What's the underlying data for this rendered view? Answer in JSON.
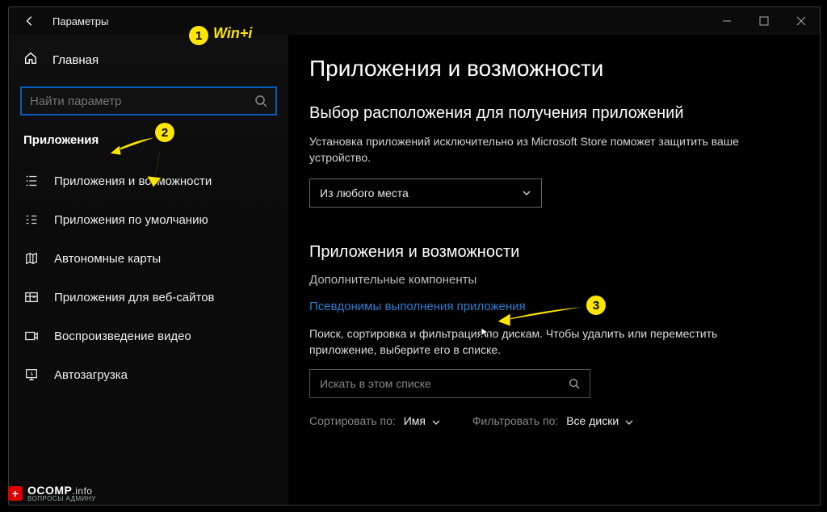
{
  "window_title": "Параметры",
  "annotations": {
    "hint1": "Win+i",
    "badge1": "1",
    "badge2": "2",
    "badge3": "3"
  },
  "sidebar": {
    "home_label": "Главная",
    "search_placeholder": "Найти параметр",
    "section_label": "Приложения",
    "items": [
      {
        "label": "Приложения и возможности"
      },
      {
        "label": "Приложения по умолчанию"
      },
      {
        "label": "Автономные карты"
      },
      {
        "label": "Приложения для веб-сайтов"
      },
      {
        "label": "Воспроизведение видео"
      },
      {
        "label": "Автозагрузка"
      }
    ]
  },
  "main": {
    "page_title": "Приложения и возможности",
    "sub1_title": "Выбор расположения для получения приложений",
    "sub1_desc": "Установка приложений исключительно из Microsoft Store поможет защитить ваше устройство.",
    "dropdown_value": "Из любого места",
    "sub2_title": "Приложения и возможности",
    "link_optional": "Дополнительные компоненты",
    "link_alias": "Псевдонимы выполнения приложения",
    "list_desc": "Поиск, сортировка и фильтрация по дискам. Чтобы удалить или переместить приложение, выберите его в списке.",
    "list_search_placeholder": "Искать в этом списке",
    "sort_label": "Сортировать по:",
    "sort_value": "Имя",
    "filter_label": "Фильтровать по:",
    "filter_value": "Все диски"
  },
  "watermark": {
    "brand": "OCOMP",
    "tld": ".info",
    "sub": "ВОПРОСЫ АДМИНУ"
  }
}
